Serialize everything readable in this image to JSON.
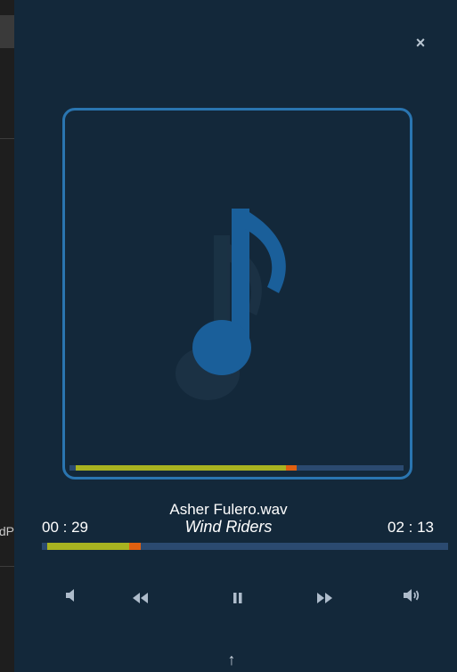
{
  "background_app": {
    "partial_text": "ndP"
  },
  "player": {
    "close_label": "×",
    "filename": "Asher Fulero.wav",
    "song_title": "Wind Riders",
    "time_elapsed": "00 : 29",
    "time_total": "02 : 13",
    "progress_fraction": 0.218,
    "album_art_icon": "music-note-icon",
    "up_label": "↑"
  },
  "controls": [
    {
      "name": "volume-down-button",
      "icon": "volume-down-icon"
    },
    {
      "name": "rewind-button",
      "icon": "rewind-icon"
    },
    {
      "name": "pause-button",
      "icon": "pause-icon"
    },
    {
      "name": "fast-forward-button",
      "icon": "fast-forward-icon"
    },
    {
      "name": "volume-up-button",
      "icon": "volume-up-icon"
    }
  ],
  "colors": {
    "panel": "#13283a",
    "accent_blue": "#1a5f9a",
    "progress_played": "#a8b320",
    "progress_head": "#e06010",
    "progress_track": "#2b4a70"
  }
}
